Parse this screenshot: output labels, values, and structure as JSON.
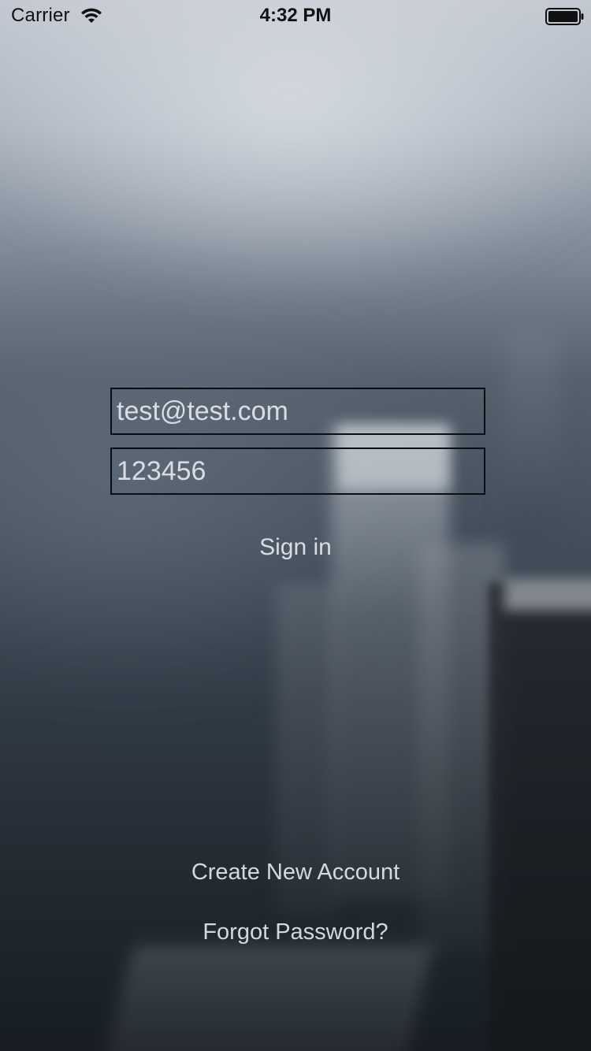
{
  "status_bar": {
    "carrier": "Carrier",
    "time": "4:32 PM",
    "wifi_icon": "wifi-icon",
    "battery_icon": "battery-full-icon"
  },
  "login_form": {
    "email_value": "test@test.com",
    "password_value": "123456",
    "sign_in_label": "Sign in"
  },
  "footer_links": {
    "create_account_label": "Create New Account",
    "forgot_password_label": "Forgot Password?"
  },
  "colors": {
    "text_light": "#e8ebf0",
    "field_border": "#0b0d10",
    "status_text": "#111111"
  }
}
